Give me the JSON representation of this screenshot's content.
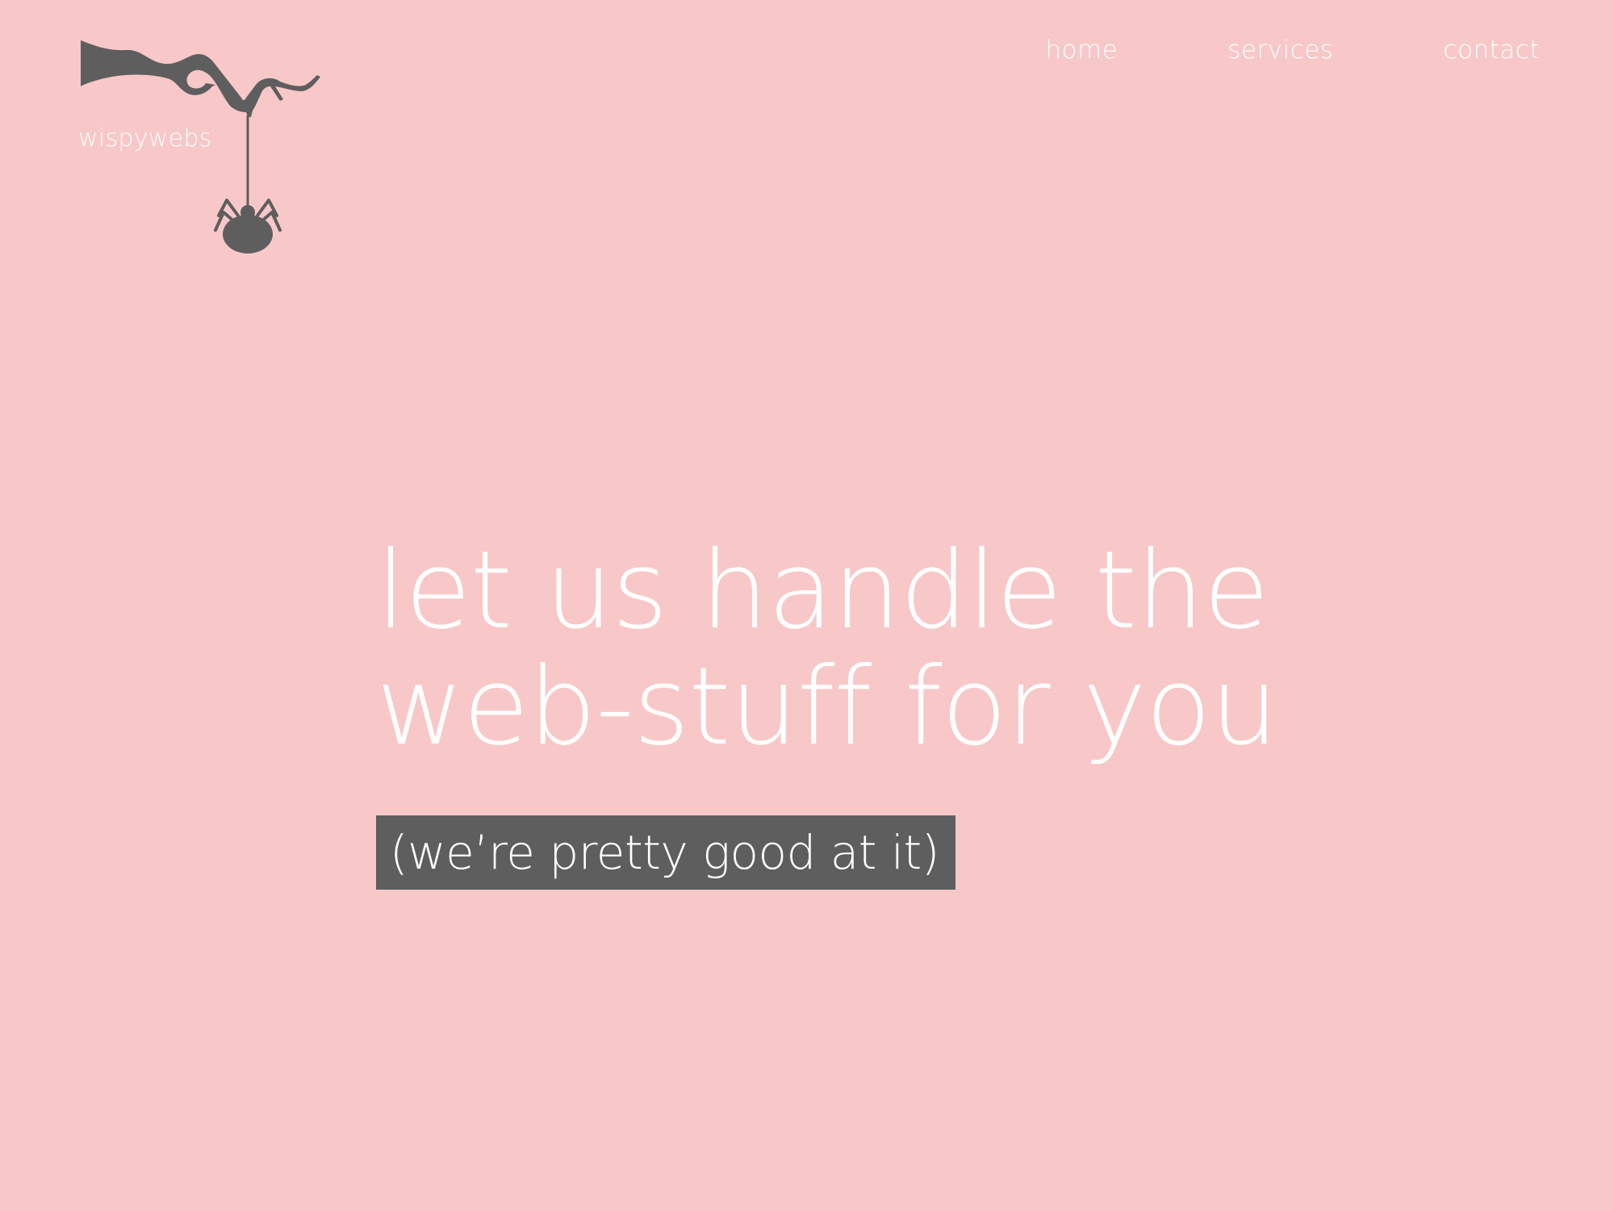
{
  "brand": {
    "name": "wispywebs",
    "logo_icon": "branch-spider-icon",
    "logo_color": "#5e5e5e"
  },
  "nav": {
    "items": [
      {
        "label": "home"
      },
      {
        "label": "services"
      },
      {
        "label": "contact"
      }
    ]
  },
  "hero": {
    "heading_line1": "let us handle the",
    "heading_line2": "web-stuff for you",
    "subheading": "(we’re pretty good at it)"
  },
  "colors": {
    "background": "#f8c8c9",
    "text": "#ffffff",
    "accent": "#5e5e5e"
  }
}
